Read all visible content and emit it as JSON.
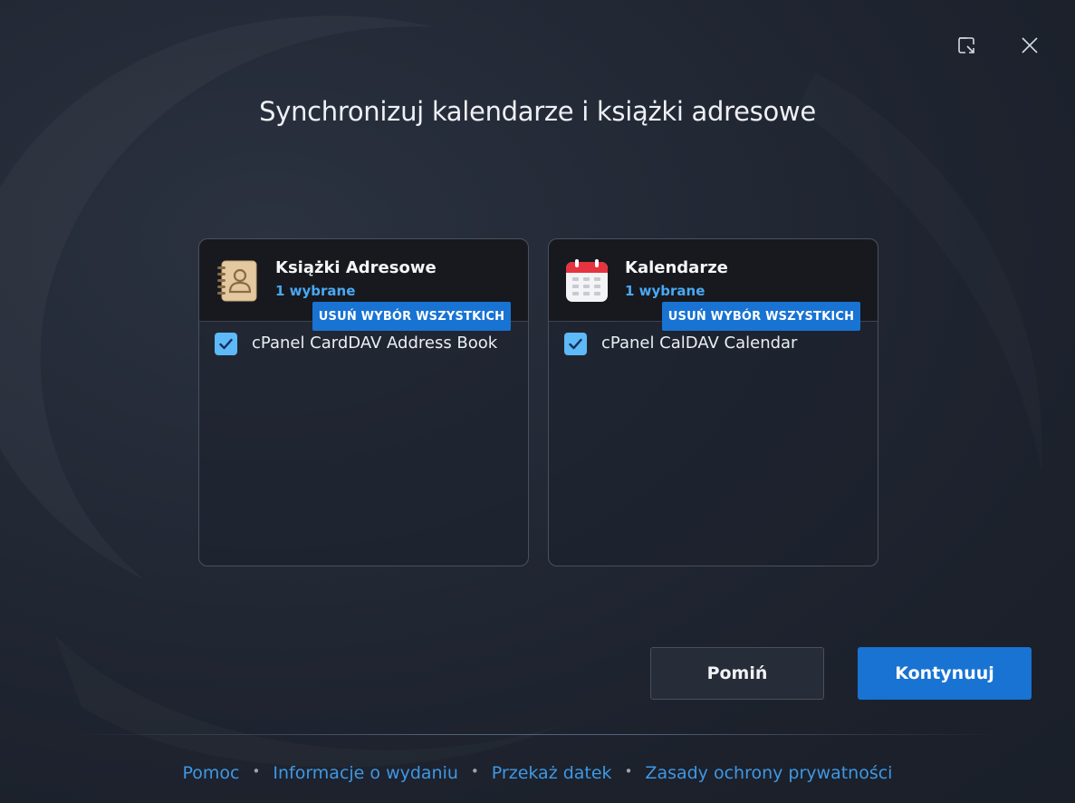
{
  "dialog": {
    "title": "Synchronizuj kalendarze i książki adresowe"
  },
  "window_controls": {
    "restore_icon": "restore-window-icon",
    "close_icon": "close-icon"
  },
  "panels": [
    {
      "title": "Książki Adresowe",
      "count": "1 wybrane",
      "icon": "address-book-icon",
      "deselect_label": "USUŃ WYBÓR WSZYSTKICH",
      "items": [
        {
          "label": "cPanel CardDAV Address Book",
          "checked": true
        }
      ]
    },
    {
      "title": "Kalendarze",
      "count": "1 wybrane",
      "icon": "calendar-icon",
      "deselect_label": "USUŃ WYBÓR WSZYSTKICH",
      "items": [
        {
          "label": "cPanel CalDAV Calendar",
          "checked": true
        }
      ]
    }
  ],
  "buttons": {
    "skip": "Pomiń",
    "continue": "Kontynuuj"
  },
  "footer": {
    "links": [
      "Pomoc",
      "Informacje o wydaniu",
      "Przekaż datek",
      "Zasady ochrony prywatności"
    ],
    "separator": "•"
  },
  "colors": {
    "accent": "#1873d3",
    "link": "#3f98e3",
    "count": "#4aa8f2",
    "checkbox": "#5db9f7",
    "background": "#222834"
  }
}
